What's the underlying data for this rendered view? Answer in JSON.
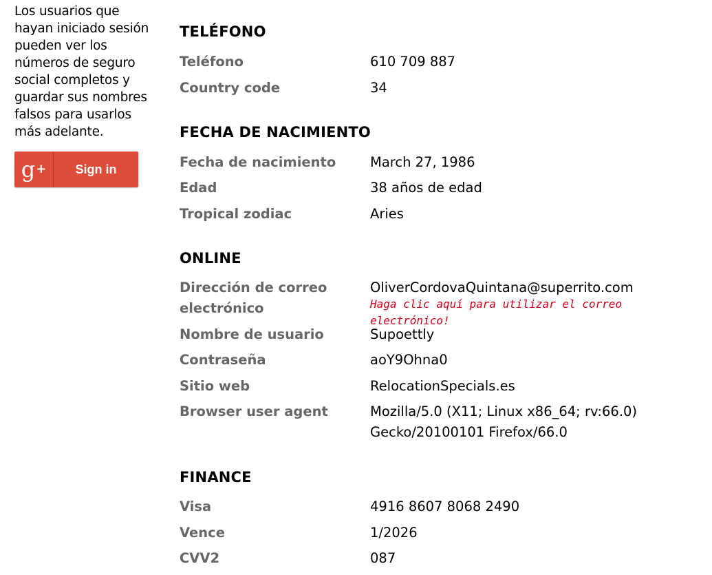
{
  "sidebar": {
    "text_lines": [
      "Los usuarios que",
      "hayan iniciado sesión",
      "pueden ver los",
      "números de seguro",
      "social completos y",
      "guardar sus nombres",
      "falsos para usarlos",
      "más adelante."
    ],
    "signin_label": "Sign in",
    "signin_logo": "g",
    "signin_logo_plus": "+",
    "signin_color": "#dd4b39"
  },
  "sections": {
    "telefono": {
      "title": "TELÉFONO",
      "rows": [
        {
          "label": "Teléfono",
          "value": "610 709 887"
        },
        {
          "label": "Country code",
          "value": "34"
        }
      ]
    },
    "nacimiento": {
      "title": "FECHA DE NACIMIENTO",
      "rows": [
        {
          "label": "Fecha de nacimiento",
          "value": "March 27, 1986"
        },
        {
          "label": "Edad",
          "value": "38 años de edad"
        },
        {
          "label": "Tropical zodiac",
          "value": "Aries"
        }
      ]
    },
    "online": {
      "title": "ONLINE",
      "email_label_1": "Dirección de correo",
      "email_label_2": "electrónico",
      "email_value": "OliverCordovaQuintana@superrito.com",
      "email_link": "Haga clic aquí para utilizar el correo electrónico!",
      "rows": [
        {
          "label": "Nombre de usuario",
          "value": "Supoettly"
        },
        {
          "label": "Contraseña",
          "value": "aoY9Ohna0"
        },
        {
          "label": "Sitio web",
          "value": "RelocationSpecials.es"
        }
      ],
      "ua_label": "Browser user agent",
      "ua_value_1": "Mozilla/5.0 (X11; Linux x86_64; rv:66.0)",
      "ua_value_2": "Gecko/20100101 Firefox/66.0"
    },
    "finance": {
      "title": "FINANCE",
      "rows": [
        {
          "label": "Visa",
          "value": "4916 8607 8068 2490"
        },
        {
          "label": "Vence",
          "value": "1/2026"
        },
        {
          "label": "CVV2",
          "value": "087"
        }
      ]
    }
  },
  "colors": {
    "label": "#666666",
    "link": "#d0021b"
  }
}
